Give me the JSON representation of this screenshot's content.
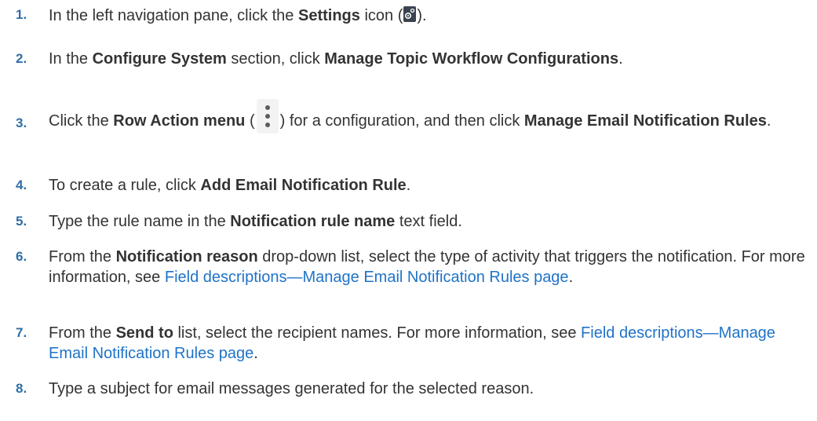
{
  "steps": [
    {
      "number": "1.",
      "t1": "In the left navigation pane, click the ",
      "b1": "Settings",
      "t2": " icon (",
      "icon": "settings-gear-icon",
      "t3": ")."
    },
    {
      "number": "2.",
      "t1": "In the ",
      "b1": "Configure System",
      "t2": " section, click ",
      "b2": "Manage Topic Workflow Configurations",
      "t3": "."
    },
    {
      "number": "3.",
      "t1": "Click the ",
      "b1": "Row Action menu",
      "t2": " (",
      "icon": "kebab-menu-icon",
      "t3": ") for a configuration, and then click ",
      "b2": "Manage Email Notification Rules",
      "t4": "."
    },
    {
      "number": "4.",
      "t1": "To create a rule, click ",
      "b1": "Add Email Notification Rule",
      "t2": "."
    },
    {
      "number": "5.",
      "t1": "Type the rule name in the ",
      "b1": "Notification rule name",
      "t2": " text field."
    },
    {
      "number": "6.",
      "t1": "From the ",
      "b1": "Notification reason",
      "t2": " drop-down list, select the type of activity that triggers the notification. For more information, see ",
      "link": "Field descriptions—Manage Email Notification Rules page",
      "t3": "."
    },
    {
      "number": "7.",
      "t1": "From the ",
      "b1": "Send to",
      "t2": " list, select the recipient names. For more information, see ",
      "link": "Field descriptions—Manage Email Notification Rules page",
      "t3": "."
    },
    {
      "number": "8.",
      "t1": "Type a subject for email messages generated for the selected reason."
    }
  ],
  "colors": {
    "step_number": "#2f6ea7",
    "link": "#1f73c9",
    "text": "#333333"
  }
}
